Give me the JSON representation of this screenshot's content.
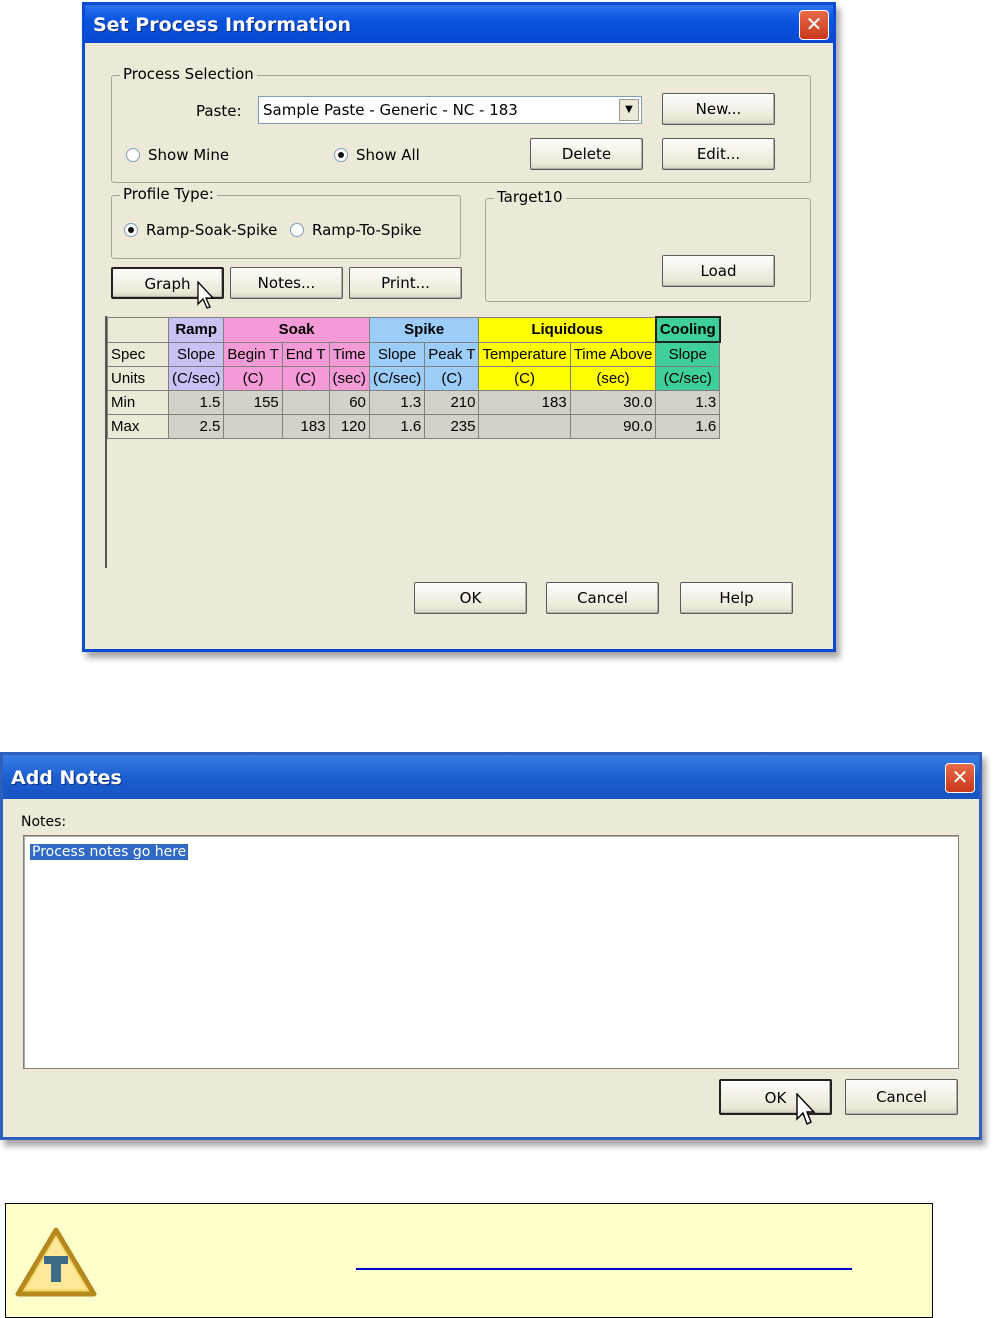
{
  "process_dialog": {
    "title": "Set Process Information",
    "close_glyph": "✕",
    "process_selection": {
      "legend": "Process Selection",
      "paste_label": "Paste:",
      "paste_value": "Sample Paste - Generic - NC - 183",
      "new_label": "New...",
      "edit_label": "Edit...",
      "delete_label": "Delete",
      "show_mine_label": "Show Mine",
      "show_all_label": "Show All",
      "show_all_selected": true
    },
    "profile_type": {
      "legend": "Profile Type:",
      "ramp_soak_spike_label": "Ramp-Soak-Spike",
      "ramp_to_spike_label": "Ramp-To-Spike",
      "selected": "Ramp-Soak-Spike"
    },
    "target": {
      "legend": "Target10",
      "load_label": "Load"
    },
    "graph_label": "Graph",
    "notes_label": "Notes...",
    "print_label": "Print...",
    "grid": {
      "groups": [
        "Ramp",
        "Soak",
        "Spike",
        "Liquidous",
        "Cooling"
      ],
      "spec_label": "Spec",
      "units_label": "Units",
      "min_label": "Min",
      "max_label": "Max",
      "spec": [
        "Slope",
        "Begin T",
        "End T",
        "Time",
        "Slope",
        "Peak T",
        "Temperature",
        "Time Above",
        "Slope"
      ],
      "units": [
        "(C/sec)",
        "(C)",
        "(C)",
        "(sec)",
        "(C/sec)",
        "(C)",
        "(C)",
        "(sec)",
        "(C/sec)"
      ],
      "min": [
        "1.5",
        "155",
        "",
        "60",
        "1.3",
        "210",
        "183",
        "30.0",
        "1.3"
      ],
      "max": [
        "2.5",
        "",
        "183",
        "120",
        "1.6",
        "235",
        "",
        "90.0",
        "1.6"
      ]
    },
    "ok_label": "OK",
    "cancel_label": "Cancel",
    "help_label": "Help"
  },
  "notes_dialog": {
    "title": "Add Notes",
    "close_glyph": "✕",
    "notes_label": "Notes:",
    "notes_text": "Process notes go here",
    "ok_label": "OK",
    "cancel_label": "Cancel"
  },
  "tip_icon": "tip-warning-triangle-icon"
}
